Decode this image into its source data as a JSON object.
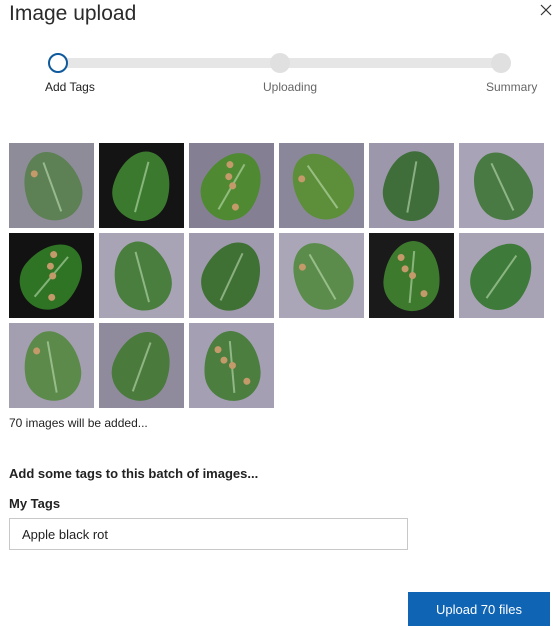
{
  "dialog": {
    "title": "Image upload",
    "close_icon": "close-icon"
  },
  "stepper": {
    "steps": [
      {
        "label": "Add Tags",
        "state": "current"
      },
      {
        "label": "Uploading",
        "state": "pending"
      },
      {
        "label": "Summary",
        "state": "pending"
      }
    ]
  },
  "colors": {
    "accent": "#0f64b4",
    "step_current_border": "#0f5a9c",
    "track": "#e6e6e6"
  },
  "thumbnails": [
    {
      "bg": "#8f8c9a",
      "leaf": "#5e8055"
    },
    {
      "bg": "#141414",
      "leaf": "#3b7a2e"
    },
    {
      "bg": "#857f93",
      "leaf": "#4f8a32"
    },
    {
      "bg": "#8b879a",
      "leaf": "#5d8f3a"
    },
    {
      "bg": "#9c97ab",
      "leaf": "#3f6e3a"
    },
    {
      "bg": "#a8a3b6",
      "leaf": "#4a7a44"
    },
    {
      "bg": "#121212",
      "leaf": "#2f7424"
    },
    {
      "bg": "#a9a4b5",
      "leaf": "#4a7e3e"
    },
    {
      "bg": "#9f9aae",
      "leaf": "#3f7034"
    },
    {
      "bg": "#aaa6b8",
      "leaf": "#5b8c4b"
    },
    {
      "bg": "#1a1a1a",
      "leaf": "#3d7a2e"
    },
    {
      "bg": "#a7a2b4",
      "leaf": "#3e7a39"
    },
    {
      "bg": "#a39eb0",
      "leaf": "#5c8a4a"
    },
    {
      "bg": "#8f8b9c",
      "leaf": "#4a7a3c"
    },
    {
      "bg": "#a49fb2",
      "leaf": "#4c7e40"
    }
  ],
  "images_note": "70 images will be added...",
  "tags": {
    "heading": "Add some tags to this batch of images...",
    "label": "My Tags",
    "value": "Apple black rot"
  },
  "upload_button": "Upload 70 files"
}
